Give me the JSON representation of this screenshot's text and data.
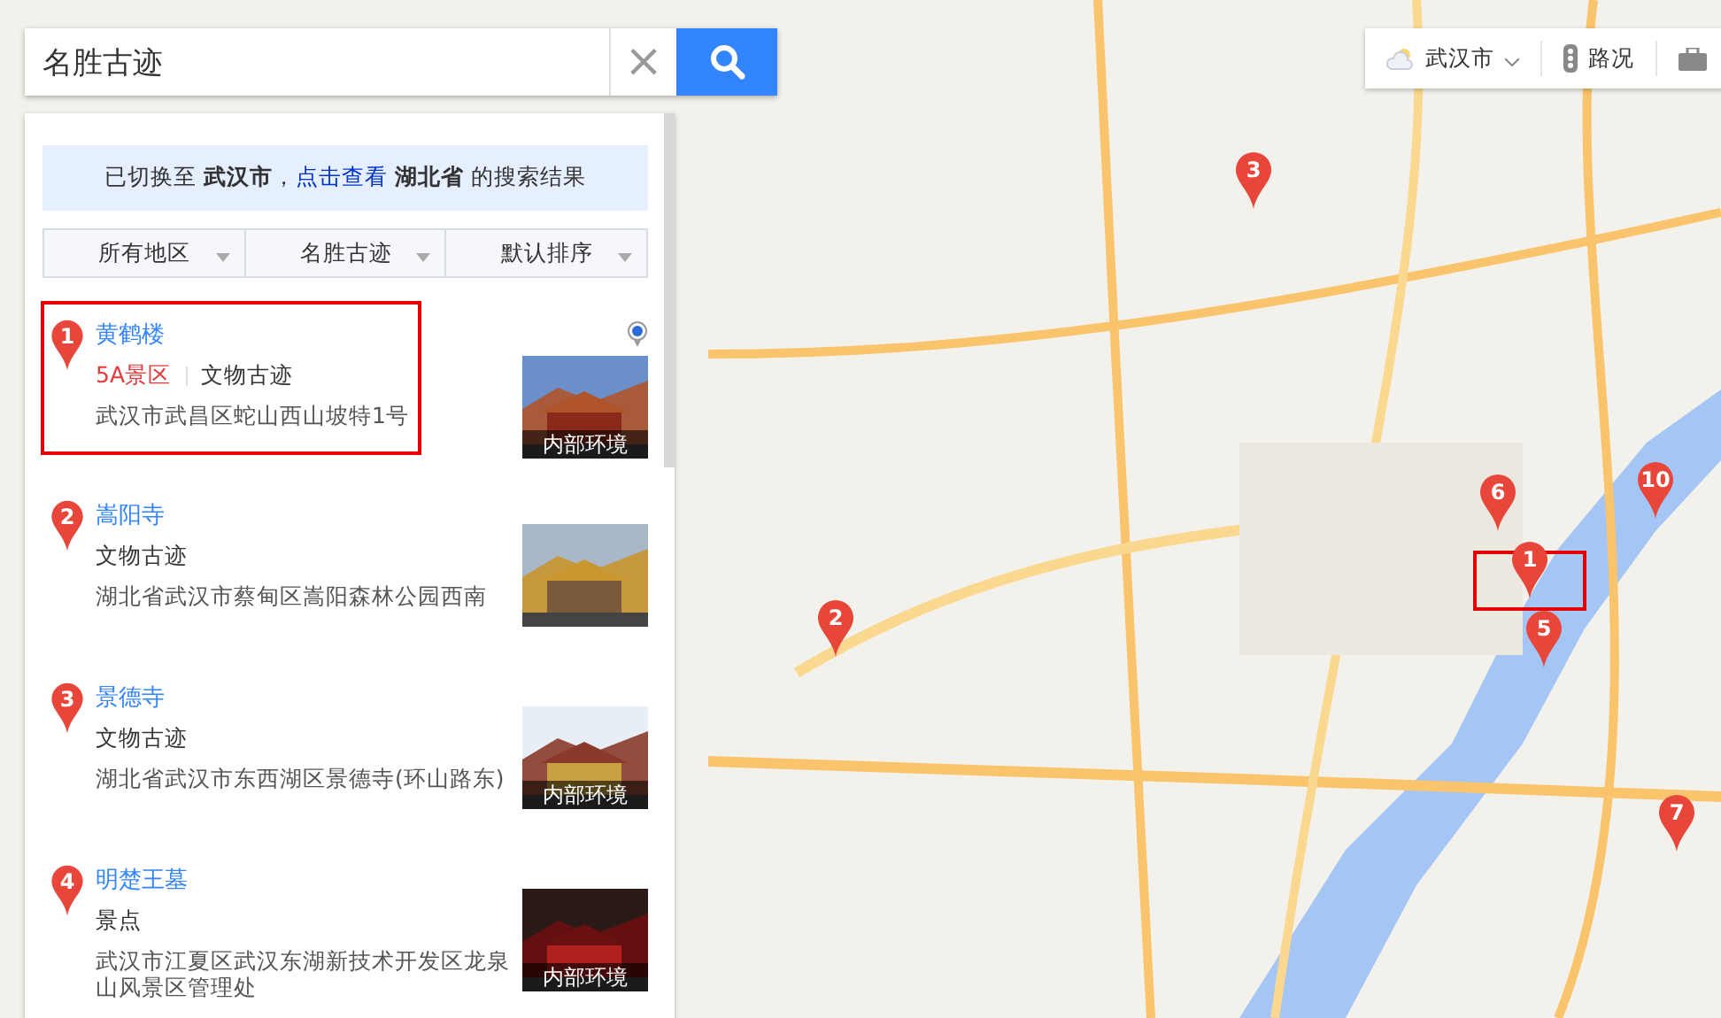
{
  "search": {
    "value": "名胜古迹",
    "clear": "×"
  },
  "map_tools": {
    "city": "武汉市",
    "traffic": "路况"
  },
  "banner": {
    "before": "已切换至 ",
    "city": "武汉市",
    "comma": "，",
    "link": "点击查看",
    "province": "湖北省",
    "after": " 的搜索结果"
  },
  "filters": [
    "所有地区",
    "名胜古迹",
    "默认排序"
  ],
  "results": [
    {
      "number": "1",
      "name": "黄鹤楼",
      "highlighted": true,
      "tags": [
        {
          "kind": "grade",
          "text": "5A景区"
        },
        {
          "kind": "category",
          "text": "文物古迹"
        }
      ],
      "address": "武汉市武昌区蛇山西山坡特1号",
      "photo_caption": "内部环境",
      "panorama": true
    },
    {
      "number": "2",
      "name": "嵩阳寺",
      "highlighted": false,
      "tags": [
        {
          "kind": "category",
          "text": "文物古迹"
        }
      ],
      "address": "湖北省武汉市蔡甸区嵩阳森林公园西南",
      "panorama": false
    },
    {
      "number": "3",
      "name": "景德寺",
      "highlighted": false,
      "tags": [
        {
          "kind": "category",
          "text": "文物古迹"
        }
      ],
      "address": "湖北省武汉市东西湖区景德寺(环山路东)",
      "photo_caption": "内部环境",
      "panorama": false
    },
    {
      "number": "4",
      "name": "明楚王墓",
      "highlighted": false,
      "tags": [
        {
          "kind": "category",
          "text": "景点"
        }
      ],
      "address": "武汉市江夏区武汉东湖新技术开发区龙泉山风景区管理处",
      "photo_caption": "内部环境",
      "panorama": false
    }
  ],
  "map_pins": [
    {
      "number": "3"
    },
    {
      "number": "2"
    },
    {
      "number": "6"
    },
    {
      "number": "10"
    },
    {
      "number": "1",
      "highlighted": true
    },
    {
      "number": "5"
    },
    {
      "number": "7"
    }
  ]
}
